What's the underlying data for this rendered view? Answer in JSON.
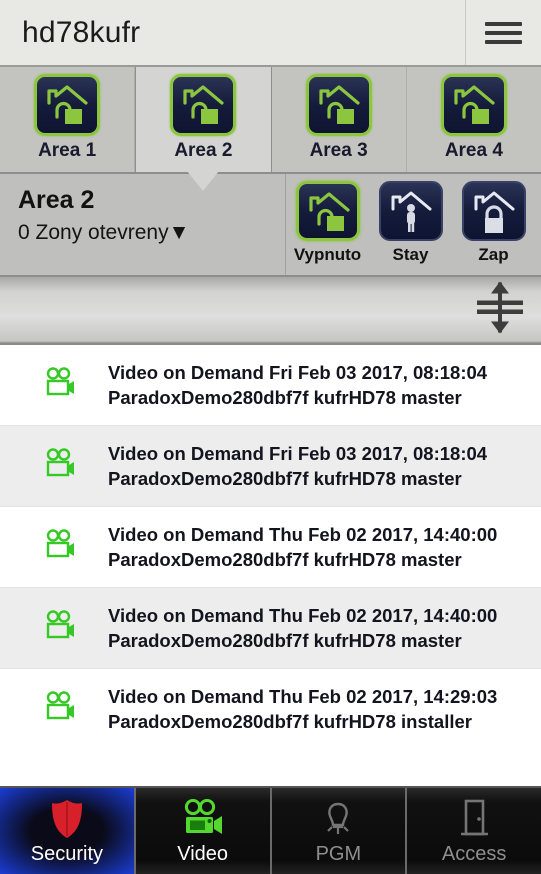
{
  "titlebar": {
    "title": "hd78kufr",
    "menu_icon": "hamburger-menu-icon"
  },
  "area_tabs": {
    "selected_index": 1,
    "items": [
      {
        "label": "Area 1",
        "icon": "house-open-lock-icon",
        "state": "disarmed"
      },
      {
        "label": "Area 2",
        "icon": "house-open-lock-icon",
        "state": "disarmed"
      },
      {
        "label": "Area 3",
        "icon": "house-open-lock-icon",
        "state": "disarmed"
      },
      {
        "label": "Area 4",
        "icon": "house-open-lock-icon",
        "state": "disarmed"
      }
    ]
  },
  "area_panel": {
    "title": "Area 2",
    "zones_status": "0 Zony otevreny",
    "zones_caret": "▼",
    "arm_buttons": [
      {
        "label": "Vypnuto",
        "icon": "house-open-lock-icon",
        "active": true
      },
      {
        "label": "Stay",
        "icon": "house-person-icon",
        "active": false
      },
      {
        "label": "Zap",
        "icon": "house-closed-lock-icon",
        "active": false
      }
    ]
  },
  "divider": {
    "resize_icon": "vertical-resize-handle-icon"
  },
  "events": {
    "rows": [
      {
        "icon": "video-camera-icon",
        "line1": "Video on Demand Fri Feb 03 2017, 08:18:04",
        "line2": "ParadoxDemo280dbf7f kufrHD78 master"
      },
      {
        "icon": "video-camera-icon",
        "line1": "Video on Demand Fri Feb 03 2017, 08:18:04",
        "line2": "ParadoxDemo280dbf7f kufrHD78 master"
      },
      {
        "icon": "video-camera-icon",
        "line1": "Video on Demand Thu Feb 02 2017, 14:40:00",
        "line2": "ParadoxDemo280dbf7f kufrHD78 master"
      },
      {
        "icon": "video-camera-icon",
        "line1": "Video on Demand Thu Feb 02 2017, 14:40:00",
        "line2": "ParadoxDemo280dbf7f kufrHD78 master"
      },
      {
        "icon": "video-camera-icon",
        "line1": "Video on Demand Thu Feb 02 2017, 14:29:03",
        "line2": "ParadoxDemo280dbf7f kufrHD78 installer"
      }
    ]
  },
  "bottom_nav": {
    "active_index": 0,
    "items": [
      {
        "label": "Security",
        "icon": "shield-icon",
        "active": true,
        "dim": false
      },
      {
        "label": "Video",
        "icon": "video-camera-icon",
        "active": false,
        "dim": false
      },
      {
        "label": "PGM",
        "icon": "light-bulb-icon",
        "active": false,
        "dim": true
      },
      {
        "label": "Access",
        "icon": "door-icon",
        "active": false,
        "dim": true
      }
    ]
  },
  "colors": {
    "accent_green": "#8cc63f",
    "video_green": "#34c924",
    "shield_red": "#d8202a",
    "active_blue": "#1b3dd6",
    "panel_gray": "#bfbfbd"
  }
}
